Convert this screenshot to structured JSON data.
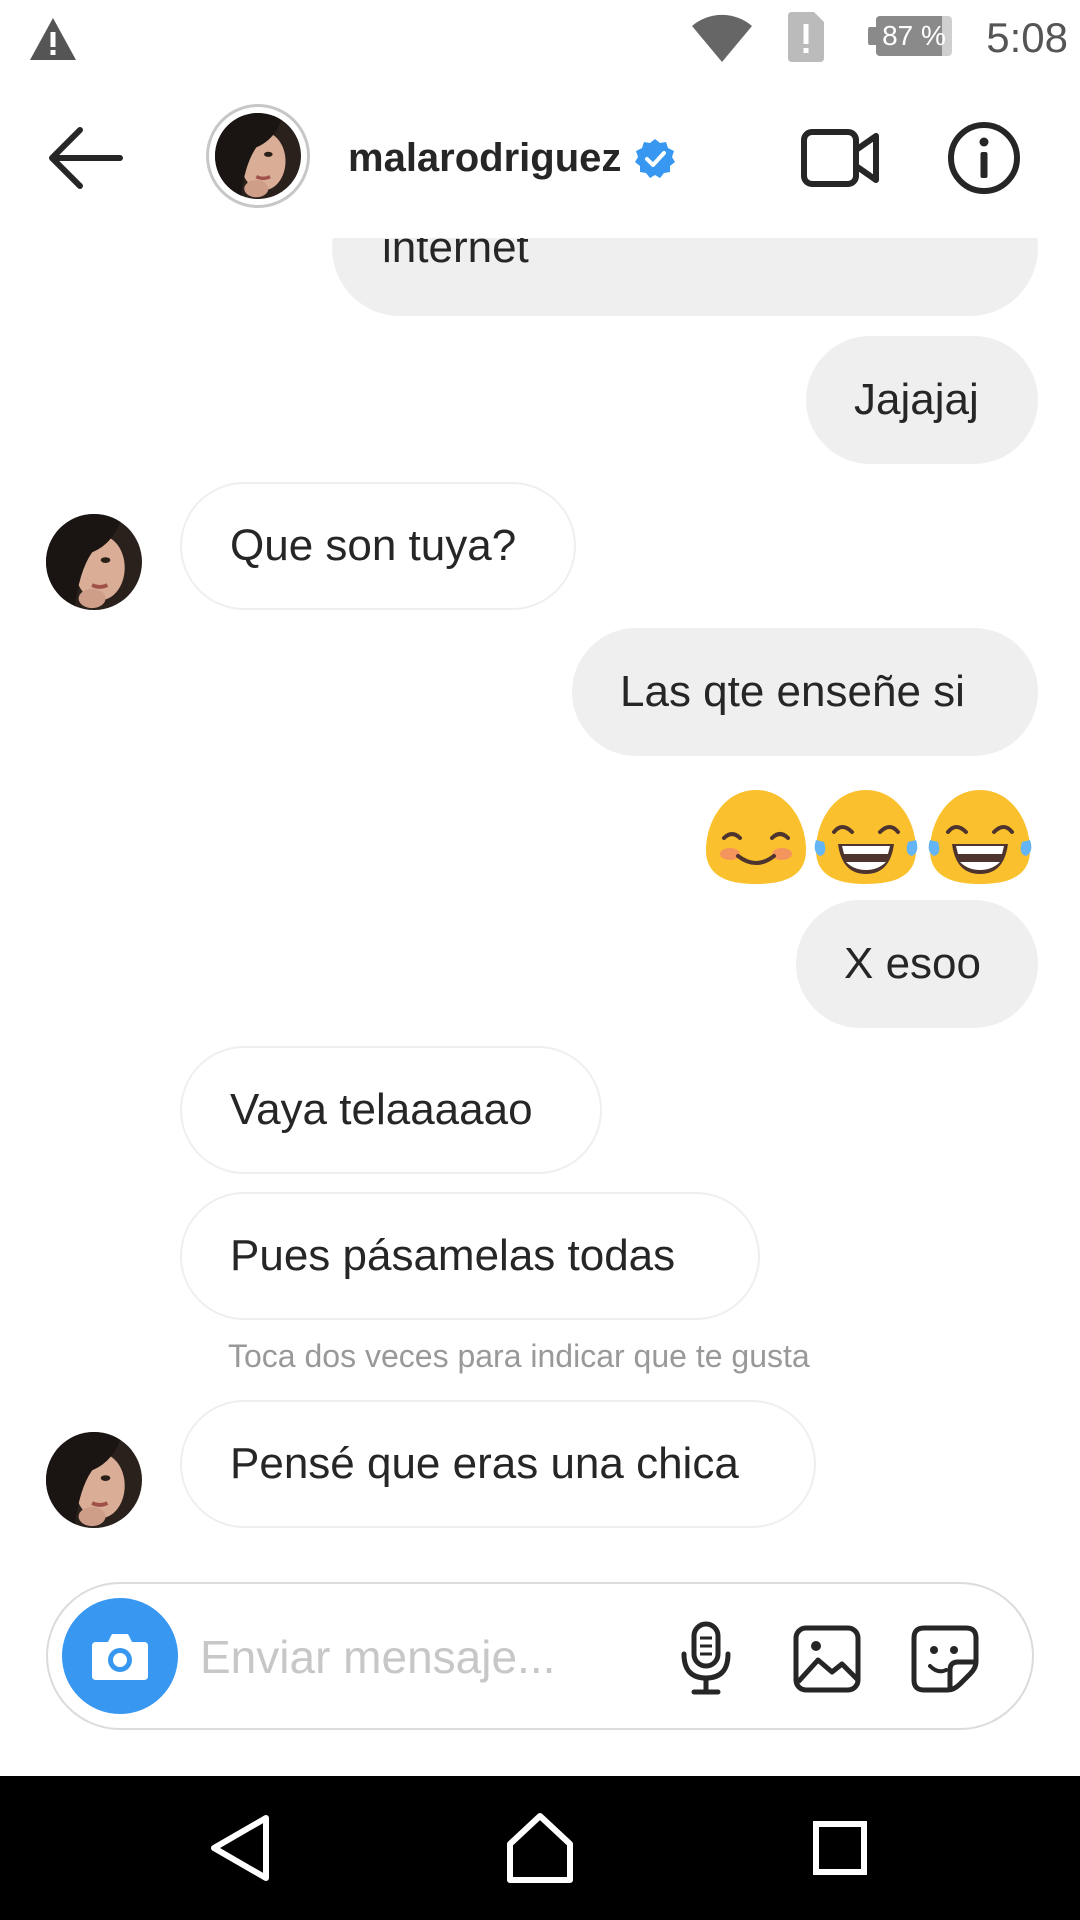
{
  "status_bar": {
    "battery_percent": 87,
    "battery_label": "87 %",
    "time": "5:08",
    "icons": [
      "warning-icon",
      "wifi-icon",
      "sim-alert-icon",
      "battery-icon"
    ]
  },
  "header": {
    "username": "malarodriguez",
    "verified": true,
    "icons": [
      "back-arrow-icon",
      "video-call-icon",
      "info-icon"
    ],
    "accent_color": "#3897f0"
  },
  "messages": [
    {
      "direction": "out",
      "text": "internet"
    },
    {
      "direction": "out",
      "text": "Jajajaj"
    },
    {
      "direction": "in",
      "text": "Que son tuya?"
    },
    {
      "direction": "out",
      "text": "Las qte enseñe si"
    },
    {
      "direction": "out",
      "type": "emoji",
      "emojis": [
        "smiling-blush-emoji",
        "tears-of-joy-emoji",
        "tears-of-joy-emoji"
      ]
    },
    {
      "direction": "out",
      "text": "X esoo"
    },
    {
      "direction": "in",
      "text": "Vaya telaaaaao"
    },
    {
      "direction": "in",
      "text": "Pues pásamelas todas"
    },
    {
      "direction": "in",
      "text": "Pensé que eras una chica"
    }
  ],
  "like_hint": "Toca dos veces para indicar que te gusta",
  "composer": {
    "placeholder": "Enviar mensaje...",
    "value": "",
    "icons": [
      "camera-icon",
      "microphone-icon",
      "gallery-icon",
      "sticker-icon"
    ]
  },
  "nav_bar": {
    "icons": [
      "nav-back-icon",
      "nav-home-icon",
      "nav-recents-icon"
    ]
  },
  "colors": {
    "outgoing_bubble": "#efefef",
    "incoming_border": "#efefef",
    "hint_text": "#999999",
    "camera_button": "#3897f0"
  }
}
